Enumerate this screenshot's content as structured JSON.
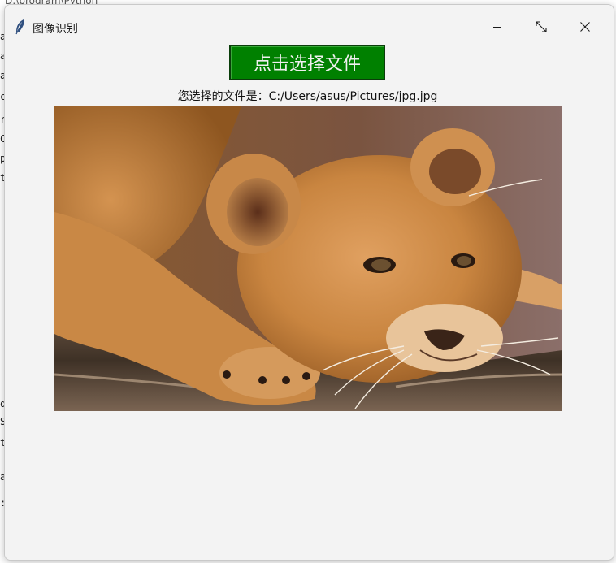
{
  "background": {
    "top_text": "D:\\program\\Python",
    "left_letters": [
      "a",
      "a",
      "a",
      "c",
      "r",
      "C",
      "p",
      "t",
      "q",
      "S",
      "t",
      "a",
      ":"
    ]
  },
  "window": {
    "title": "图像识别",
    "icon": "feather-icon",
    "controls": {
      "minimize": "minimize-icon",
      "maximize": "maximize-icon",
      "close": "close-icon"
    }
  },
  "main": {
    "select_button_label": "点击选择文件",
    "path_label": "您选择的文件是：C:/Users/asus/Pictures/jpg.jpg",
    "image_alt": "lion cub lying on a log",
    "button_color": "#008000"
  }
}
